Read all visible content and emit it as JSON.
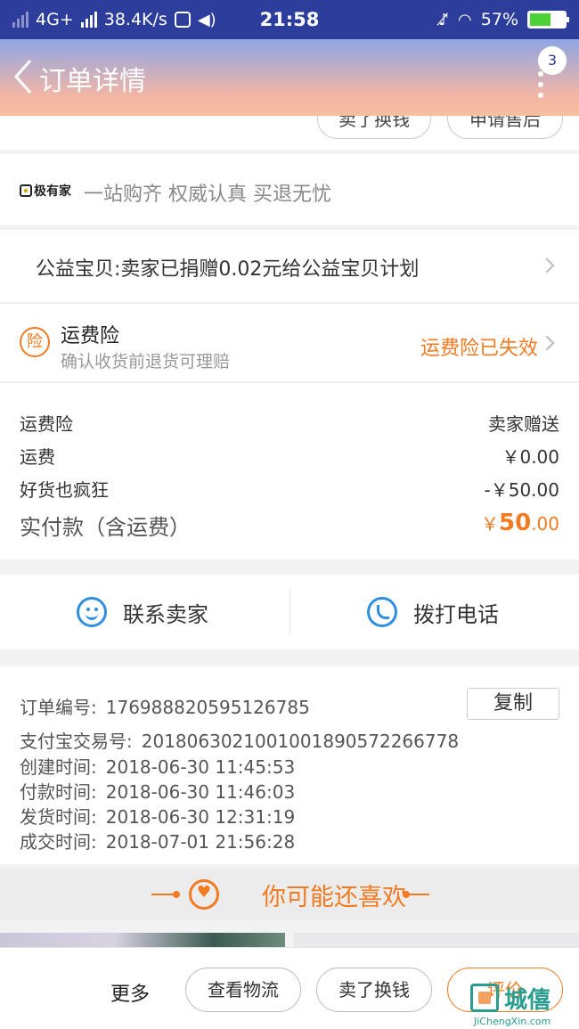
{
  "status_bar": {
    "network": "4G+",
    "speed": "38.4K/s",
    "time": "21:58",
    "battery": "57%",
    "battery_level": 0.57
  },
  "header": {
    "title": "订单详情",
    "badge": "3"
  },
  "top_strip": {
    "btn1": "卖了换钱",
    "btn2": "申请售后"
  },
  "brand": {
    "logo_text": "极有家",
    "slogan": "一站购齐 权威认真 买退无忧"
  },
  "charity": {
    "text": "公益宝贝:卖家已捐赠0.02元给公益宝贝计划"
  },
  "insurance": {
    "icon_char": "险",
    "title": "运费险",
    "subtitle": "确认收货前退货可理赔",
    "status": "运费险已失效"
  },
  "fees": {
    "rows": [
      {
        "label": "运费险",
        "value": "卖家赠送"
      },
      {
        "label": "运费",
        "value": "￥0.00"
      },
      {
        "label": "好货也疯狂",
        "value": "-￥50.00"
      }
    ],
    "total_label": "实付款（含运费）",
    "total_currency": "￥",
    "total_int": "50",
    "total_dec": ".00"
  },
  "contact": {
    "seller": "联系卖家",
    "phone": "拨打电话"
  },
  "order_info": {
    "copy": "复制",
    "rows": [
      {
        "label": "订单编号:",
        "value": "176988820595126785"
      },
      {
        "label": "支付宝交易号:",
        "value": "2018063021001001890572266778"
      },
      {
        "label": "创建时间:",
        "value": "2018-06-30 11:45:53"
      },
      {
        "label": "付款时间:",
        "value": "2018-06-30 11:46:03"
      },
      {
        "label": "发货时间:",
        "value": "2018-06-30 12:31:19"
      },
      {
        "label": "成交时间:",
        "value": "2018-07-01 21:56:28"
      }
    ]
  },
  "guess": {
    "title": "你可能还喜欢"
  },
  "bottom_bar": {
    "more": "更多",
    "logistics": "查看物流",
    "sell": "卖了换钱",
    "review": "评价"
  },
  "watermark": {
    "text": "城",
    "text2": "僖",
    "sub": "JiChengXin.com"
  },
  "colors": {
    "accent": "#f27a21",
    "status_bar": "#2d3d9c",
    "icon_blue": "#2f8fe0"
  }
}
